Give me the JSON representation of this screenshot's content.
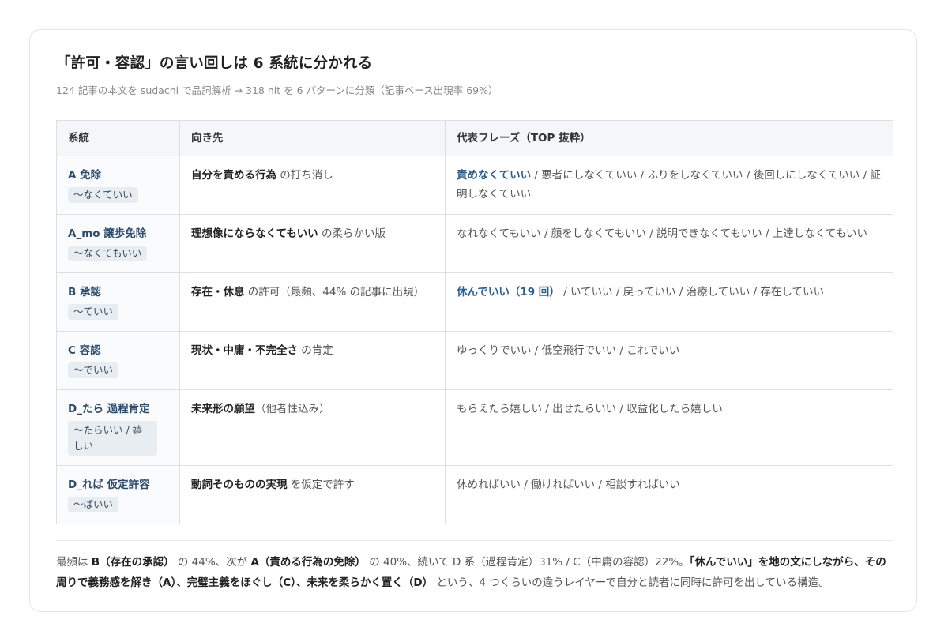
{
  "title": "「許可・容認」の言い回しは 6 系統に分かれる",
  "subtitle": "124 記事の本文を sudachi で品詞解析 → 318 hit を 6 パターンに分類（記事ベース出現率 69%）",
  "table": {
    "headers": [
      "系統",
      "向き先",
      "代表フレーズ（TOP 抜粋）"
    ],
    "rows": [
      {
        "name": "A 免除",
        "pattern": "〜なくていい",
        "target_bold": "自分を責める行為",
        "target_rest": " の打ち消し",
        "phrase_highlight": "責めなくていい",
        "phrases": " / 悪者にしなくていい / ふりをしなくていい / 後回しにしなくていい / 証明しなくていい"
      },
      {
        "name": "A_mo 譲歩免除",
        "pattern": "〜なくてもいい",
        "target_bold": "理想像にならなくてもいい",
        "target_rest": " の柔らかい版",
        "phrase_highlight": "",
        "phrases": "なれなくてもいい / 顔をしなくてもいい / 説明できなくてもいい / 上達しなくてもいい"
      },
      {
        "name": "B 承認",
        "pattern": "〜ていい",
        "target_bold": "存在・休息",
        "target_rest": " の許可（最頻、44% の記事に出現）",
        "phrase_highlight": "休んでいい（19 回）",
        "phrases": " / いていい / 戻っていい / 治療していい / 存在していい"
      },
      {
        "name": "C 容認",
        "pattern": "〜でいい",
        "target_bold": "現状・中庸・不完全さ",
        "target_rest": " の肯定",
        "phrase_highlight": "",
        "phrases": "ゆっくりでいい / 低空飛行でいい / これでいい"
      },
      {
        "name": "D_たら 過程肯定",
        "pattern": "〜たらいい / 嬉しい",
        "target_bold": "未来形の願望",
        "target_rest": "（他者性込み）",
        "phrase_highlight": "",
        "phrases": "もらえたら嬉しい / 出せたらいい / 収益化したら嬉しい"
      },
      {
        "name": "D_れば 仮定許容",
        "pattern": "〜ばいい",
        "target_bold": "動詞そのものの実現",
        "target_rest": " を仮定で許す",
        "phrase_highlight": "",
        "phrases": "休めればいい / 働ければいい / 相談すればいい"
      }
    ]
  },
  "summary": {
    "p1": "最頻は ",
    "b1": "B（存在の承認）",
    "p2": " の 44%、次が ",
    "b2": "A（責める行為の免除）",
    "p3": " の 40%、続いて D 系（過程肯定）31% / C（中庸の容認）22%。",
    "b3": "「休んでいい」を地の文にしながら、その周りで義務感を解き（A）、完璧主義をほぐし（C）、未来を柔らかく置く（D）",
    "p4": " という、4 つくらいの違うレイヤーで自分と読者に同時に許可を出している構造。"
  }
}
